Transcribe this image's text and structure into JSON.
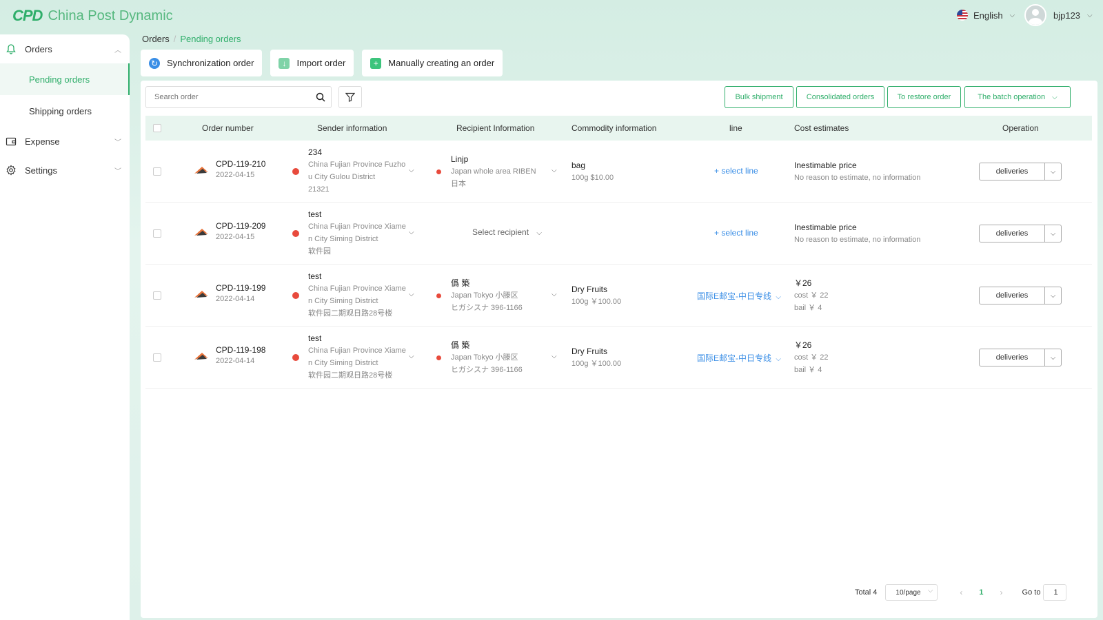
{
  "app": {
    "logo_mark": "CPD",
    "name": "China Post Dynamic"
  },
  "header": {
    "language": "English",
    "username": "bjp123"
  },
  "sidebar": {
    "groups": [
      {
        "label": "Orders",
        "icon": "bell-icon",
        "expanded": true,
        "items": [
          {
            "label": "Pending orders",
            "active": true
          },
          {
            "label": "Shipping orders",
            "active": false
          }
        ]
      },
      {
        "label": "Expense",
        "icon": "wallet-icon",
        "expanded": false
      },
      {
        "label": "Settings",
        "icon": "gear-icon",
        "expanded": false
      }
    ]
  },
  "breadcrumb": {
    "root": "Orders",
    "current": "Pending orders"
  },
  "actions": {
    "sync": "Synchronization order",
    "import": "Import order",
    "manual": "Manually creating an order"
  },
  "toolbar": {
    "search_placeholder": "Search order",
    "bulk_shipment": "Bulk shipment",
    "consolidated": "Consolidated orders",
    "restore": "To restore order",
    "batch": "The batch operation"
  },
  "table": {
    "headers": {
      "order": "Order number",
      "sender": "Sender information",
      "recipient": "Recipient Information",
      "commodity": "Commodity information",
      "line": "line",
      "cost": "Cost estimates",
      "operation": "Operation"
    },
    "rows": [
      {
        "order_no": "CPD-119-210",
        "date": "2022-04-15",
        "sender": {
          "name": "234",
          "l1": "China Fujian Province Fuzho",
          "l2": "u City Gulou District",
          "l3": "21321"
        },
        "recipient": {
          "name": "Linjp",
          "l1": "Japan whole area RIBEN",
          "l2": "日本"
        },
        "commodity": {
          "name": "bag",
          "detail": "100g   $10.00"
        },
        "line": "+ select line",
        "cost": {
          "title": "Inestimable price",
          "l1": "No reason to estimate, no information",
          "l2": ""
        },
        "op": "deliveries"
      },
      {
        "order_no": "CPD-119-209",
        "date": "2022-04-15",
        "sender": {
          "name": "test",
          "l1": "China Fujian Province Xiame",
          "l2": "n City Siming District",
          "l3": "软件园"
        },
        "recipient_placeholder": "Select recipient",
        "line": "+ select line",
        "cost": {
          "title": "Inestimable price",
          "l1": "No reason to estimate, no information",
          "l2": ""
        },
        "op": "deliveries"
      },
      {
        "order_no": "CPD-119-199",
        "date": "2022-04-14",
        "sender": {
          "name": "test",
          "l1": "China Fujian Province Xiame",
          "l2": "n City Siming District",
          "l3": "软件园二期观日路28号楼"
        },
        "recipient": {
          "name": "僞 築",
          "l1": "Japan Tokyo 小滕区",
          "l2": "ヒガシスナ 396-1166"
        },
        "commodity": {
          "name": "Dry Fruits",
          "detail": "100g   ￥100.00"
        },
        "line": "国际E邮宝-中日专线",
        "cost": {
          "title": "￥26",
          "l1": "cost ￥ 22",
          "l2": "bail ￥ 4"
        },
        "op": "deliveries"
      },
      {
        "order_no": "CPD-119-198",
        "date": "2022-04-14",
        "sender": {
          "name": "test",
          "l1": "China Fujian Province Xiame",
          "l2": "n City Siming District",
          "l3": "软件园二期观日路28号楼"
        },
        "recipient": {
          "name": "僞 築",
          "l1": "Japan Tokyo 小滕区",
          "l2": "ヒガシスナ 396-1166"
        },
        "commodity": {
          "name": "Dry Fruits",
          "detail": "100g   ￥100.00"
        },
        "line": "国际E邮宝-中日专线",
        "cost": {
          "title": "￥26",
          "l1": "cost ￥ 22",
          "l2": "bail ￥ 4"
        },
        "op": "deliveries"
      }
    ]
  },
  "pagination": {
    "total": "Total 4",
    "page_size": "10/page",
    "current_page": "1",
    "goto_label": "Go to",
    "goto_value": "1"
  },
  "colors": {
    "accent": "#2fae6a",
    "link": "#3a8ee6",
    "dot": "#e84a3c"
  }
}
